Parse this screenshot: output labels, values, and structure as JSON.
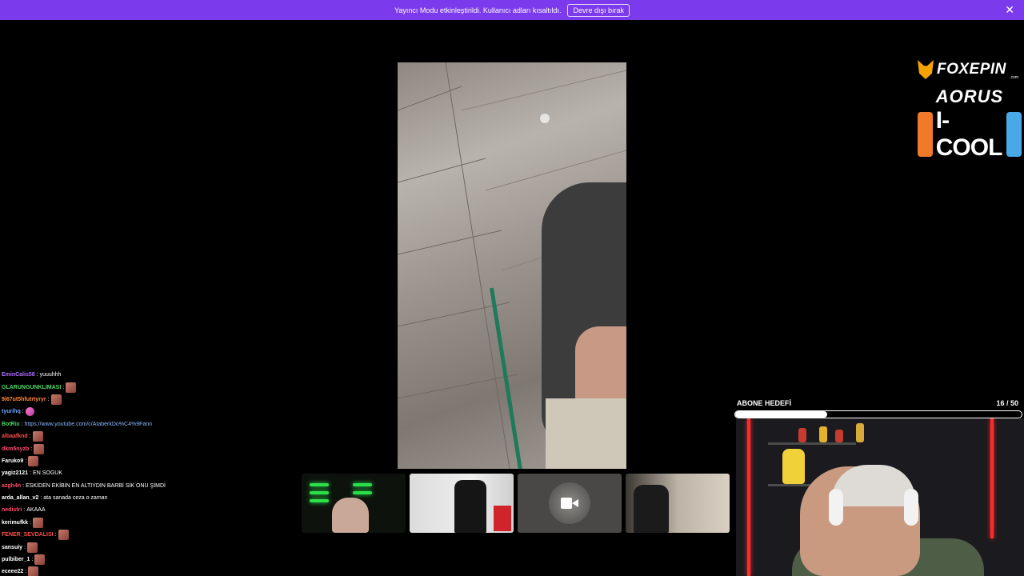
{
  "banner": {
    "text": "Yayıncı Modu etkinleştirildi. Kullanıcı adları kısaltıldı.",
    "button_label": "Devre dışı bırak",
    "close_symbol": "✕",
    "color": "#7c3aed"
  },
  "sponsors": {
    "foxepin": "FOXEPIN",
    "foxepin_domain": ".com",
    "aorus": "AORUS",
    "icool": "I-COOL"
  },
  "chat": [
    {
      "user": "EminCalis58",
      "color": "#b16cff",
      "msg": "yuuuhhh",
      "emote": ""
    },
    {
      "user": "GLARUNGUNKLIMASI",
      "color": "#4cd964",
      "msg": "",
      "emote": "red"
    },
    {
      "user": "9i67ut5hfutrtyryr",
      "color": "#ff8a3d",
      "msg": "",
      "emote": "red"
    },
    {
      "user": "tyurihq",
      "color": "#6fa8ff",
      "msg": "",
      "emote": "pink"
    },
    {
      "user": "BotRix",
      "color": "#4cd964",
      "msg": "",
      "link": "https://www.youtube.com/c/AtaberkDo%C4%9Fann",
      "emote": ""
    },
    {
      "user": "albaafknd",
      "color": "#ff4d4d",
      "msg": "",
      "emote": "red"
    },
    {
      "user": "dkm5nyzb",
      "color": "#ff4d6a",
      "msg": "",
      "emote": "red"
    },
    {
      "user": "Faruko9",
      "color": "#ffffff",
      "msg": "",
      "emote": "red"
    },
    {
      "user": "yagiz2121",
      "color": "#ffffff",
      "msg": "EN SOGUK",
      "emote": ""
    },
    {
      "user": "azgh4n",
      "color": "#ff4d6a",
      "msg": "ESKİDEN EKİBİN EN ALTIYDIN BARBİ SİK ONU ŞİMDİ",
      "emote": ""
    },
    {
      "user": "arda_allan_v2",
      "color": "#ffffff",
      "msg": "ata sanada ceza o zaman",
      "emote": ""
    },
    {
      "user": "nedistri",
      "color": "#ff4d6a",
      "msg": "AKAAA",
      "emote": ""
    },
    {
      "user": "kerimufkk",
      "color": "#ffffff",
      "msg": "",
      "emote": "red"
    },
    {
      "user": "FENER_SEVDALISI",
      "color": "#ff4d4d",
      "msg": "",
      "emote": "red"
    },
    {
      "user": "sansuiy",
      "color": "#ffffff",
      "msg": "",
      "emote": "red"
    },
    {
      "user": "pulbiber_1",
      "color": "#ffffff",
      "msg": "",
      "emote": "red"
    },
    {
      "user": "eceee22",
      "color": "#ffffff",
      "msg": "",
      "emote": "red"
    }
  ],
  "goal": {
    "title": "ABONE HEDEFİ",
    "current": "16",
    "target": " / 50",
    "progress_fraction": 0.32
  },
  "icons": {
    "camera": "camera-icon",
    "close": "close-icon"
  }
}
